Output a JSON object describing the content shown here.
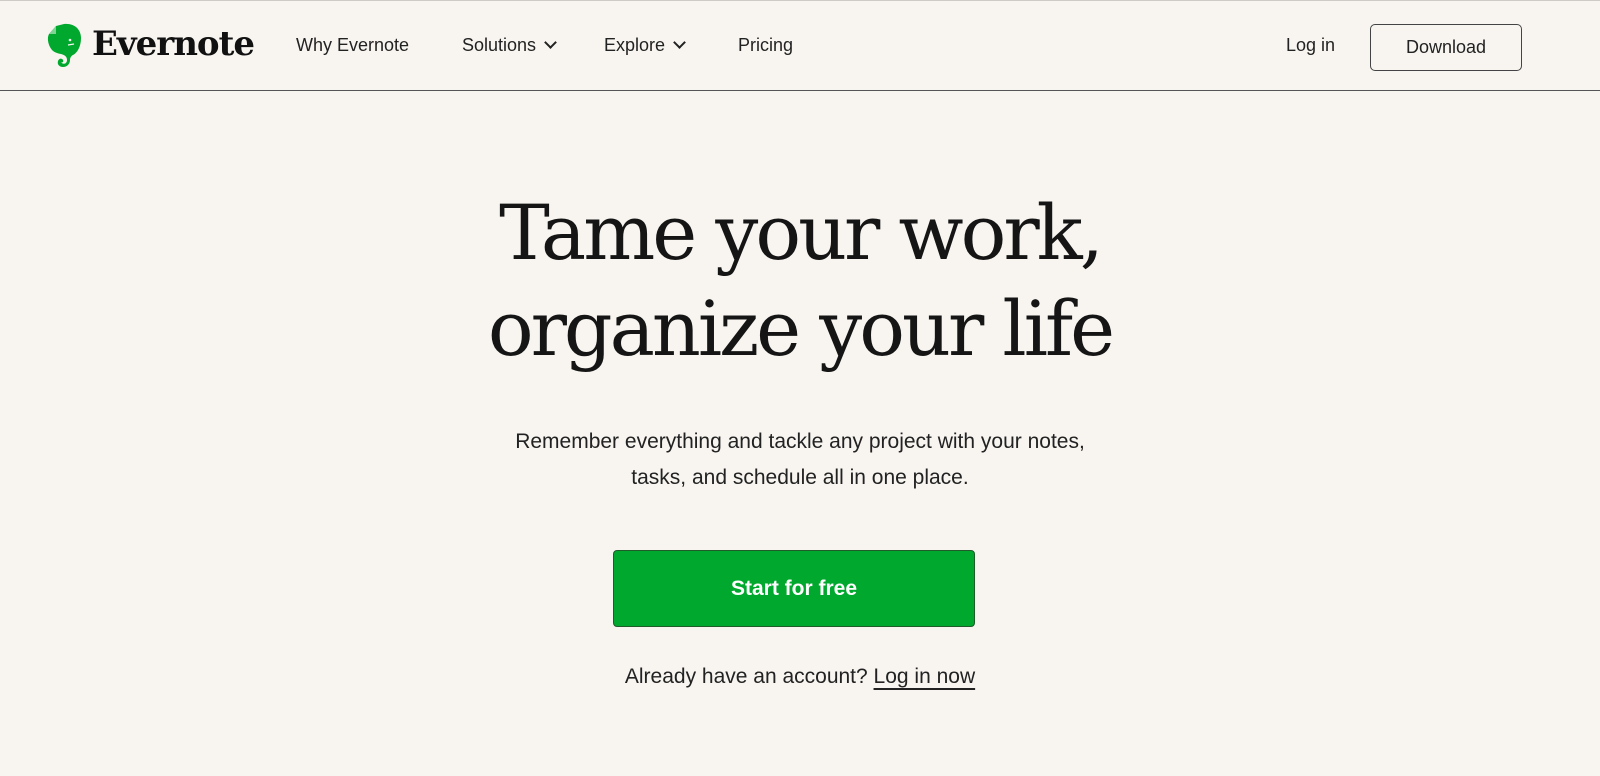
{
  "brand": {
    "name": "Evernote",
    "accent_color": "#00a82d"
  },
  "nav": {
    "items": [
      {
        "label": "Why Evernote",
        "has_dropdown": false
      },
      {
        "label": "Solutions",
        "has_dropdown": true
      },
      {
        "label": "Explore",
        "has_dropdown": true
      },
      {
        "label": "Pricing",
        "has_dropdown": false
      }
    ],
    "login_label": "Log in",
    "download_label": "Download"
  },
  "hero": {
    "title_line1": "Tame your work,",
    "title_line2": "organize your life",
    "subtitle_line1": "Remember everything and tackle any project with your notes,",
    "subtitle_line2": "tasks, and schedule all in one place.",
    "cta_label": "Start for free",
    "account_prompt": "Already have an account?",
    "account_link": "Log in now"
  }
}
